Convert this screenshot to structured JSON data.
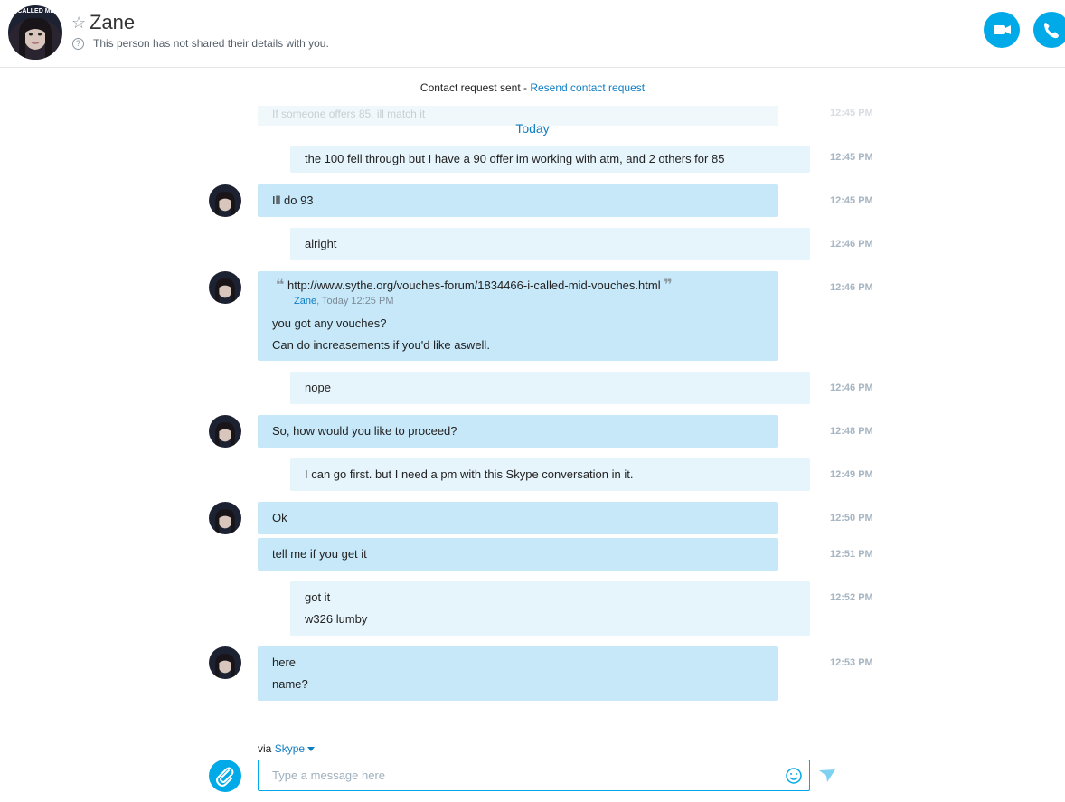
{
  "header": {
    "contact_name": "Zane",
    "details_text": "This person has not shared their details with you.",
    "avatar_text": "I CALLED MID"
  },
  "banner": {
    "status": "Contact request sent",
    "separator": " - ",
    "resend_label": "Resend contact request"
  },
  "conversation": {
    "faded_text": "If someone offers 85, ill match it",
    "faded_time": "12:45 PM",
    "day_label": "Today",
    "messages": [
      {
        "lines": [
          "the 100 fell through but I have a 90 offer im working with atm, and 2 others for 85"
        ],
        "time": "12:45 PM"
      },
      {
        "lines": [
          "Ill do 93"
        ],
        "time": "12:45 PM"
      },
      {
        "lines": [
          "alright"
        ],
        "time": "12:46 PM"
      },
      {
        "quote_url": "http://www.sythe.org/vouches-forum/1834466-i-called-mid-vouches.html",
        "quote_author": "Zane",
        "quote_time": ", Today 12:25 PM",
        "lines": [
          "you got any vouches?",
          "Can do increasements if you'd like aswell."
        ],
        "time": "12:46 PM"
      },
      {
        "lines": [
          "nope"
        ],
        "time": "12:46 PM"
      },
      {
        "lines": [
          "So, how would you like to proceed?"
        ],
        "time": "12:48 PM"
      },
      {
        "lines": [
          "I can go first. but I need a pm with this Skype conversation in it."
        ],
        "time": "12:49 PM"
      },
      {
        "lines": [
          "Ok"
        ],
        "time": "12:50 PM"
      },
      {
        "lines": [
          "tell me if you get it"
        ],
        "time": "12:51 PM"
      },
      {
        "lines": [
          "got it",
          "w326 lumby"
        ],
        "time": "12:52 PM"
      },
      {
        "lines": [
          "here",
          "name?"
        ],
        "time": "12:53 PM"
      }
    ]
  },
  "composer": {
    "via_label": "via",
    "via_service": "Skype",
    "placeholder": "Type a message here"
  },
  "icons": {
    "star": "star-icon",
    "info": "info-icon",
    "video": "video-camera-icon",
    "phone": "phone-icon",
    "attach": "paperclip-icon",
    "emoji": "smiley-icon",
    "send": "send-icon",
    "dropdown": "caret-down-icon"
  },
  "colors": {
    "accent": "#00a9e8",
    "link": "#0f7dc2",
    "incoming_bubble": "#c7e8f9",
    "outgoing_bubble": "#e6f4fb",
    "timestamp": "#a6b5c2"
  }
}
